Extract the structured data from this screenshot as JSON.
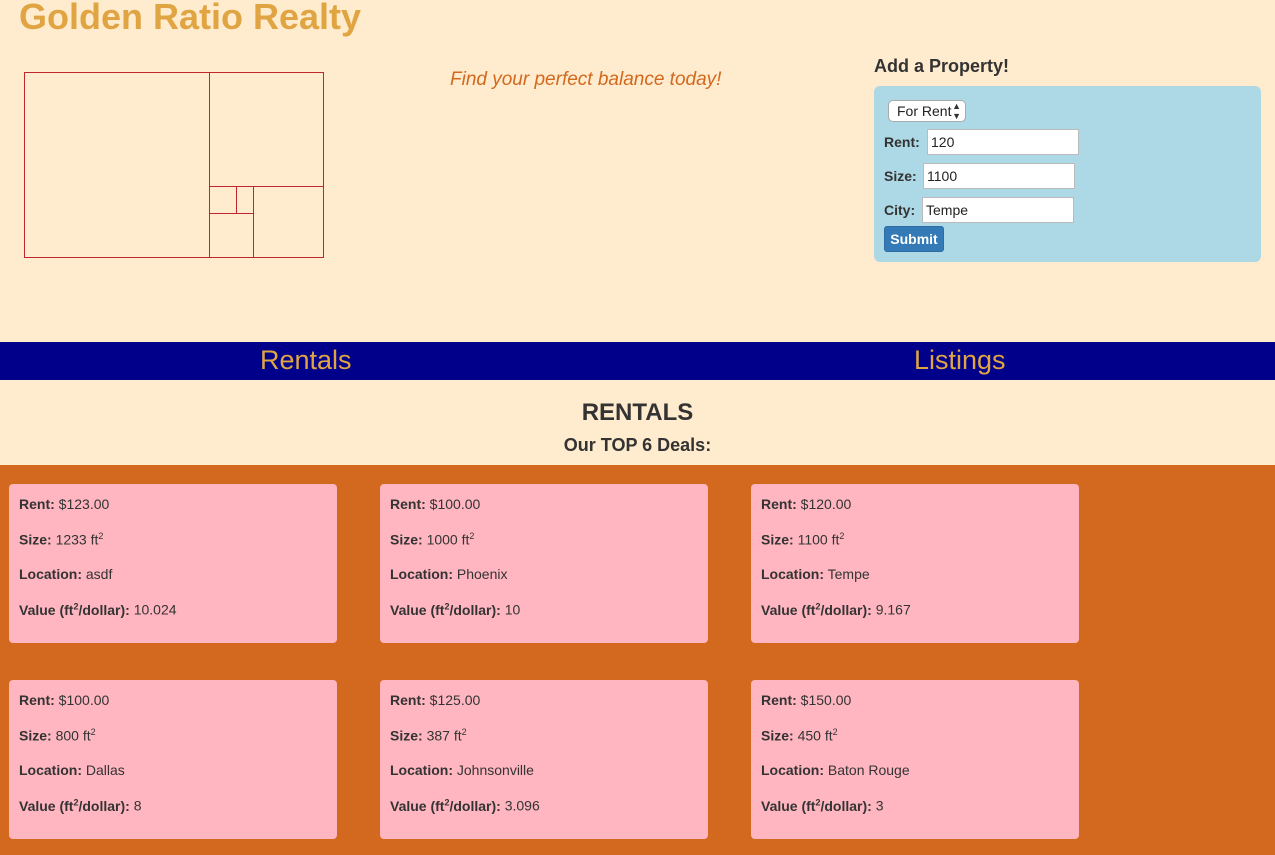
{
  "header": {
    "site_title": "Golden Ratio Realty",
    "tagline": "Find your perfect balance today!",
    "logo_color": "#c0272d"
  },
  "add_property": {
    "title": "Add a Property!",
    "type_selected": "For Rent",
    "rent_label": "Rent:",
    "rent_value": "120",
    "size_label": "Size:",
    "size_value": "1100",
    "city_label": "City:",
    "city_value": "Tempe",
    "submit_label": "Submit"
  },
  "nav": {
    "rentals": "Rentals",
    "listings": "Listings"
  },
  "section": {
    "title": "RENTALS",
    "subtitle": "Our TOP 6 Deals:"
  },
  "labels": {
    "rent": "Rent:",
    "size": "Size:",
    "location": "Location:",
    "value_prefix": "Value (ft",
    "value_suffix": "/dollar):",
    "unit": "ft",
    "sup": "2"
  },
  "deals": [
    {
      "rent": "$123.00",
      "size": "1233",
      "location": "asdf",
      "value": "10.024"
    },
    {
      "rent": "$100.00",
      "size": "1000",
      "location": "Phoenix",
      "value": "10"
    },
    {
      "rent": "$120.00",
      "size": "1100",
      "location": "Tempe",
      "value": "9.167"
    },
    {
      "rent": "$100.00",
      "size": "800",
      "location": "Dallas",
      "value": "8"
    },
    {
      "rent": "$125.00",
      "size": "387",
      "location": "Johnsonville",
      "value": "3.096"
    },
    {
      "rent": "$150.00",
      "size": "450",
      "location": "Baton Rouge",
      "value": "3"
    }
  ],
  "colors": {
    "background": "#ffebcd",
    "accent": "#e0a542",
    "tagline": "#d2691e",
    "form": "#add8e6",
    "nav": "#00008b",
    "deals_bg": "#d2691e",
    "card": "#ffb6c1",
    "button": "#337ab7"
  }
}
